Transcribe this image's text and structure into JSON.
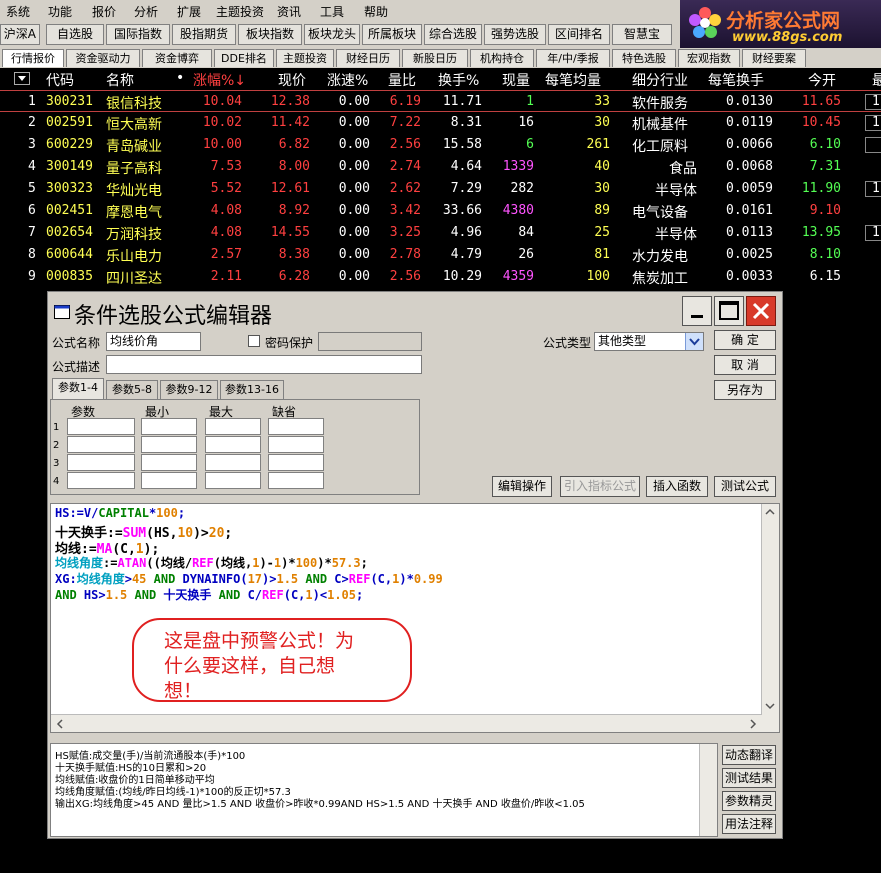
{
  "menu": [
    "系统",
    "功能",
    "报价",
    "分析",
    "扩展",
    "主题投资",
    "资讯",
    "工具",
    "帮助"
  ],
  "toolbar": [
    "沪深A股",
    "自选股",
    "国际指数",
    "股指期货",
    "板块指数",
    "板块龙头",
    "所属板块",
    "综合选股",
    "强势选股",
    "区间排名",
    "智慧宝"
  ],
  "logo": {
    "title": "分析家公式网",
    "url": "www.88gs.com"
  },
  "tabs": [
    "行情报价",
    "资金驱动力",
    "资金博弈",
    "DDE排名",
    "主题投资",
    "财经日历",
    "新股日历",
    "机构持仓",
    "年/中/季报",
    "特色选股",
    "宏观指数",
    "财经要案"
  ],
  "grid": {
    "headers": [
      "代码",
      "名称",
      "•",
      "涨幅%↓",
      "现价",
      "涨速%",
      "量比",
      "换手%",
      "现量",
      "每笔均量",
      "细分行业",
      "每笔换手",
      "今开",
      "最"
    ],
    "rows": [
      {
        "n": "1",
        "code": "300231",
        "name": "银信科技",
        "chg": "10.04",
        "price": "12.38",
        "spd": "0.00",
        "vr": "6.19",
        "tr": "11.71",
        "vol": "1",
        "avg": "33",
        "ind": "软件服务",
        "ptr": "0.0130",
        "open": "11.65",
        "extra": "1"
      },
      {
        "n": "2",
        "code": "002591",
        "name": "恒大高新",
        "chg": "10.02",
        "price": "11.42",
        "spd": "0.00",
        "vr": "7.22",
        "tr": "8.31",
        "vol": "16",
        "avg": "30",
        "ind": "机械基件",
        "ptr": "0.0119",
        "open": "10.45",
        "extra": "1"
      },
      {
        "n": "3",
        "code": "600229",
        "name": "青岛碱业",
        "chg": "10.00",
        "price": "6.82",
        "spd": "0.00",
        "vr": "2.56",
        "tr": "15.58",
        "vol": "6",
        "avg": "261",
        "ind": "化工原料",
        "ptr": "0.0066",
        "open": "6.10",
        "extra": ""
      },
      {
        "n": "4",
        "code": "300149",
        "name": "量子高科",
        "chg": "7.53",
        "price": "8.00",
        "spd": "0.00",
        "vr": "2.74",
        "tr": "4.64",
        "vol": "1339",
        "avg": "40",
        "ind": "食品",
        "ptr": "0.0068",
        "open": "7.31",
        "extra": ""
      },
      {
        "n": "5",
        "code": "300323",
        "name": "华灿光电",
        "chg": "5.52",
        "price": "12.61",
        "spd": "0.00",
        "vr": "2.62",
        "tr": "7.29",
        "vol": "282",
        "avg": "30",
        "ind": "半导体",
        "ptr": "0.0059",
        "open": "11.90",
        "extra": "1"
      },
      {
        "n": "6",
        "code": "002451",
        "name": "摩恩电气",
        "chg": "4.08",
        "price": "8.92",
        "spd": "0.00",
        "vr": "3.42",
        "tr": "33.66",
        "vol": "4380",
        "avg": "89",
        "ind": "电气设备",
        "ptr": "0.0161",
        "open": "9.10",
        "extra": ""
      },
      {
        "n": "7",
        "code": "002654",
        "name": "万润科技",
        "chg": "4.08",
        "price": "14.55",
        "spd": "0.00",
        "vr": "3.25",
        "tr": "4.96",
        "vol": "84",
        "avg": "25",
        "ind": "半导体",
        "ptr": "0.0113",
        "open": "13.95",
        "extra": "1"
      },
      {
        "n": "8",
        "code": "600644",
        "name": "乐山电力",
        "chg": "2.57",
        "price": "8.38",
        "spd": "0.00",
        "vr": "2.78",
        "tr": "4.79",
        "vol": "26",
        "avg": "81",
        "ind": "水力发电",
        "ptr": "0.0025",
        "open": "8.10",
        "extra": ""
      },
      {
        "n": "9",
        "code": "000835",
        "name": "四川圣达",
        "chg": "2.11",
        "price": "6.28",
        "spd": "0.00",
        "vr": "2.56",
        "tr": "10.29",
        "vol": "4359",
        "avg": "100",
        "ind": "焦炭加工",
        "ptr": "0.0033",
        "open": "6.15",
        "extra": ""
      }
    ]
  },
  "dialog": {
    "title": "条件选股公式编辑器",
    "name_label": "公式名称",
    "name_value": "均线价角",
    "pwd_label": "密码保护",
    "type_label": "公式类型",
    "type_value": "其他类型",
    "desc_label": "公式描述",
    "btn_ok": "确 定",
    "btn_cancel": "取 消",
    "btn_saveas": "另存为",
    "param_tabs": [
      "参数1-4",
      "参数5-8",
      "参数9-12",
      "参数13-16"
    ],
    "param_headers": [
      "参数",
      "最小",
      "最大",
      "缺省"
    ],
    "param_rows": [
      "1",
      "2",
      "3",
      "4"
    ],
    "btn_edit": "编辑操作",
    "btn_import": "引入指标公式",
    "btn_insert": "插入函数",
    "btn_test": "测试公式",
    "code": [
      "HS:=V/CAPITAL*100;",
      "十天换手:=SUM(HS,10)>20;",
      "均线:=MA(C,1);",
      "均线角度:=ATAN((均线/REF(均线,1)-1)*100)*57.3;",
      "XG:均线角度>45 AND DYNAINFO(17)>1.5 AND C>REF(C,1)*0.99",
      "AND HS>1.5 AND 十天换手 AND C/REF(C,1)<1.05;"
    ],
    "bubble": [
      "这是盘中预警公式！为",
      "什么要这样，自己想",
      "想！"
    ],
    "desc_lines": [
      "HS赋值:成交量(手)/当前流通股本(手)*100",
      "十天换手赋值:HS的10日累和>20",
      "均线赋值:收盘价的1日简单移动平均",
      "均线角度赋值:(均线/昨日均线-1)*100的反正切*57.3",
      "输出XG:均线角度>45 AND 量比>1.5 AND 收盘价>昨收*0.99AND HS>1.5 AND 十天换手 AND 收盘价/昨收<1.05"
    ],
    "side_btns": [
      "动态翻译",
      "测试结果",
      "参数精灵",
      "用法注释"
    ]
  }
}
